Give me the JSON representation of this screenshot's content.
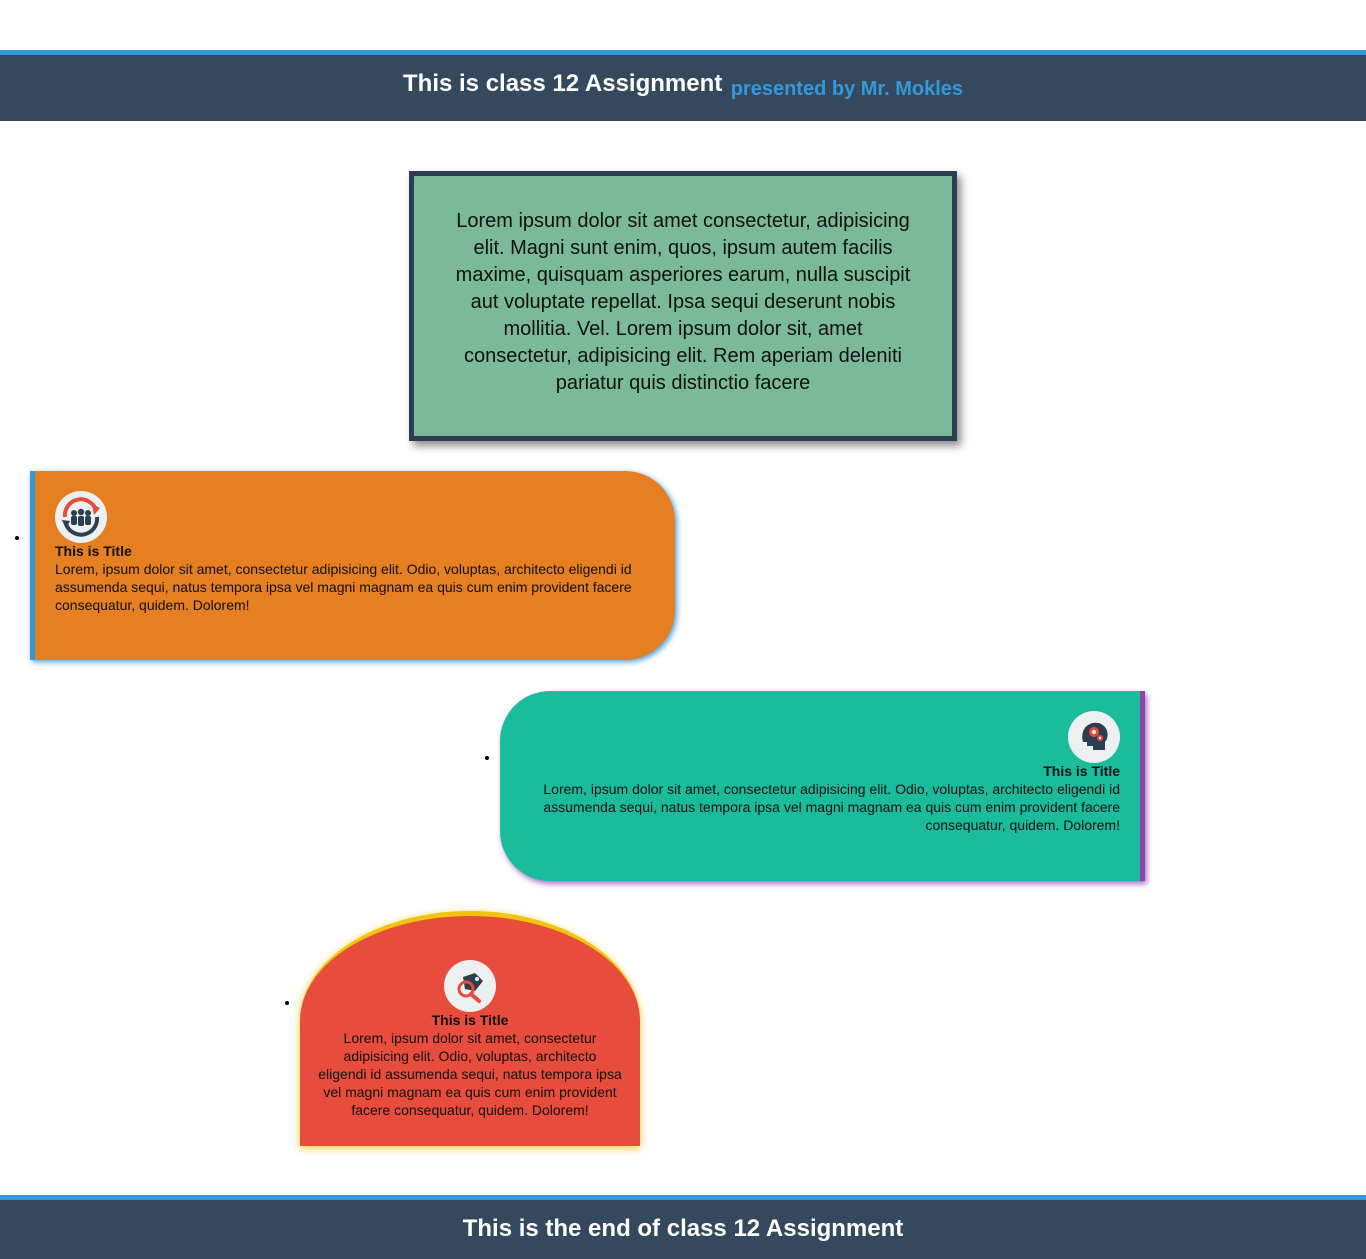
{
  "header": {
    "title": "This is class 12 Assignment",
    "subtitle": "presented by Mr. Mokles"
  },
  "intro": {
    "text": "Lorem ipsum dolor sit amet consectetur, adipisicing elit. Magni sunt enim, quos, ipsum autem facilis maxime, quisquam asperiores earum, nulla suscipit aut voluptate repellat. Ipsa sequi deserunt nobis mollitia. Vel. Lorem ipsum dolor sit, amet consectetur, adipisicing elit. Rem aperiam deleniti pariatur quis distinctio facere"
  },
  "cards": [
    {
      "icon": "team-cycle-icon",
      "title": "This is Title",
      "text": "Lorem, ipsum dolor sit amet, consectetur adipisicing elit. Odio, voluptas, architecto eligendi id assumenda sequi, natus tempora ipsa vel magni magnam ea quis cum enim provident facere consequatur, quidem. Dolorem!",
      "background": "#e67e22",
      "accent": "#3498db"
    },
    {
      "icon": "head-gears-icon",
      "title": "This is Title",
      "text": "Lorem, ipsum dolor sit amet, consectetur adipisicing elit. Odio, voluptas, architecto eligendi id assumenda sequi, natus tempora ipsa vel magni magnam ea quis cum enim provident facere consequatur, quidem. Dolorem!",
      "background": "#1abc9c",
      "accent": "#8e44ad"
    },
    {
      "icon": "tag-search-icon",
      "title": "This is Title",
      "text": "Lorem, ipsum dolor sit amet, consectetur adipisicing elit. Odio, voluptas, architecto eligendi id assumenda sequi, natus tempora ipsa vel magni magnam ea quis cum enim provident facere consequatur, quidem. Dolorem!",
      "background": "#e74c3c",
      "accent": "#f1c40f"
    }
  ],
  "footer": {
    "title": "This is the end of class 12 Assignment"
  },
  "colors": {
    "header_bg": "#34495e",
    "header_accent": "#3498db",
    "intro_bg": "#7ab99a",
    "intro_border": "#2c3e50"
  }
}
